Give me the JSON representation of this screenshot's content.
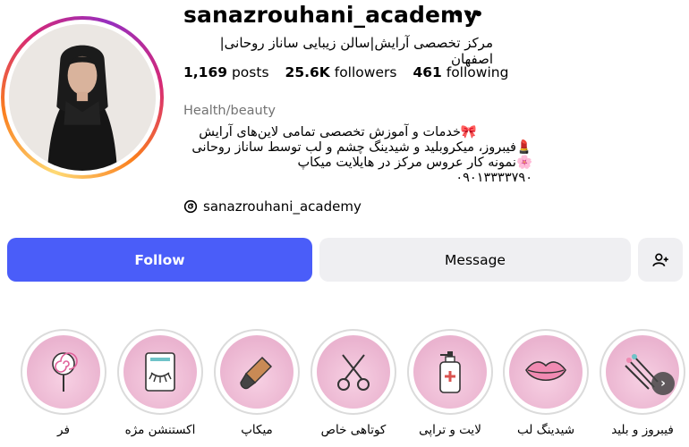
{
  "profile": {
    "username": "sanazrouhani_academy",
    "fullname": "مرکز تخصصی آرایش|سالن زیبایی ساناز روحانی|اصفهان",
    "category": "Health/beauty",
    "threads_handle": "sanazrouhani_academy"
  },
  "stats": {
    "posts_count": "1,169",
    "posts_label": "posts",
    "followers_count": "25.6K",
    "followers_label": "followers",
    "following_count": "461",
    "following_label": "following"
  },
  "bio": {
    "line1": "🎀خدمات و آموزش تخصصی تمامی لاین‌های آرایش",
    "line2": "💄فیبروز، میکروبلید و شیدینگ چشم و لب توسط ساناز روحانی",
    "line3": "🌸نمونه کار عروس مرکز در هایلایت میکاپ",
    "line4": "۰۹۰۱۳۳۳۳۷۹۰"
  },
  "actions": {
    "follow": "Follow",
    "message": "Message"
  },
  "highlights": [
    {
      "label": "فر",
      "icon": "lollipop-icon"
    },
    {
      "label": "اکستنشن مژه",
      "icon": "eyelash-extension-icon"
    },
    {
      "label": "میکاپ",
      "icon": "makeup-brush-icon"
    },
    {
      "label": "کوتاهی خاص",
      "icon": "scissors-icon"
    },
    {
      "label": "لایت و تراپی",
      "icon": "lotion-bottle-icon"
    },
    {
      "label": "شیدینگ لب",
      "icon": "lips-icon"
    },
    {
      "label": "فیبروز و بلید",
      "icon": "microblading-tools-icon"
    }
  ],
  "colors": {
    "follow_button": "#4a5df9",
    "secondary_button": "#efeff2",
    "highlight_fill": "#eab3cf",
    "category_text": "#737373"
  }
}
